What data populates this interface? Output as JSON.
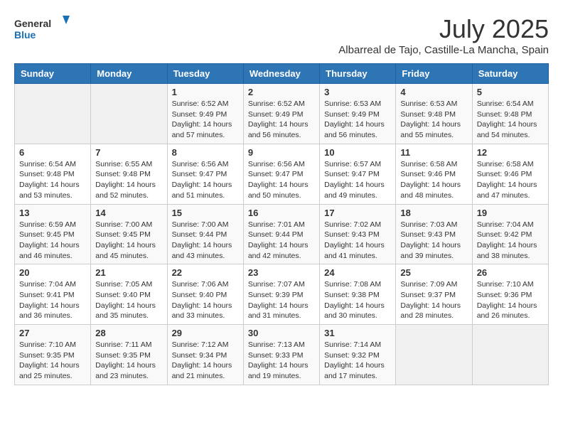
{
  "logo": {
    "general": "General",
    "blue": "Blue"
  },
  "title": "July 2025",
  "subtitle": "Albarreal de Tajo, Castille-La Mancha, Spain",
  "days_of_week": [
    "Sunday",
    "Monday",
    "Tuesday",
    "Wednesday",
    "Thursday",
    "Friday",
    "Saturday"
  ],
  "weeks": [
    [
      {
        "day": "",
        "info": ""
      },
      {
        "day": "",
        "info": ""
      },
      {
        "day": "1",
        "info": "Sunrise: 6:52 AM\nSunset: 9:49 PM\nDaylight: 14 hours and 57 minutes."
      },
      {
        "day": "2",
        "info": "Sunrise: 6:52 AM\nSunset: 9:49 PM\nDaylight: 14 hours and 56 minutes."
      },
      {
        "day": "3",
        "info": "Sunrise: 6:53 AM\nSunset: 9:49 PM\nDaylight: 14 hours and 56 minutes."
      },
      {
        "day": "4",
        "info": "Sunrise: 6:53 AM\nSunset: 9:48 PM\nDaylight: 14 hours and 55 minutes."
      },
      {
        "day": "5",
        "info": "Sunrise: 6:54 AM\nSunset: 9:48 PM\nDaylight: 14 hours and 54 minutes."
      }
    ],
    [
      {
        "day": "6",
        "info": "Sunrise: 6:54 AM\nSunset: 9:48 PM\nDaylight: 14 hours and 53 minutes."
      },
      {
        "day": "7",
        "info": "Sunrise: 6:55 AM\nSunset: 9:48 PM\nDaylight: 14 hours and 52 minutes."
      },
      {
        "day": "8",
        "info": "Sunrise: 6:56 AM\nSunset: 9:47 PM\nDaylight: 14 hours and 51 minutes."
      },
      {
        "day": "9",
        "info": "Sunrise: 6:56 AM\nSunset: 9:47 PM\nDaylight: 14 hours and 50 minutes."
      },
      {
        "day": "10",
        "info": "Sunrise: 6:57 AM\nSunset: 9:47 PM\nDaylight: 14 hours and 49 minutes."
      },
      {
        "day": "11",
        "info": "Sunrise: 6:58 AM\nSunset: 9:46 PM\nDaylight: 14 hours and 48 minutes."
      },
      {
        "day": "12",
        "info": "Sunrise: 6:58 AM\nSunset: 9:46 PM\nDaylight: 14 hours and 47 minutes."
      }
    ],
    [
      {
        "day": "13",
        "info": "Sunrise: 6:59 AM\nSunset: 9:45 PM\nDaylight: 14 hours and 46 minutes."
      },
      {
        "day": "14",
        "info": "Sunrise: 7:00 AM\nSunset: 9:45 PM\nDaylight: 14 hours and 45 minutes."
      },
      {
        "day": "15",
        "info": "Sunrise: 7:00 AM\nSunset: 9:44 PM\nDaylight: 14 hours and 43 minutes."
      },
      {
        "day": "16",
        "info": "Sunrise: 7:01 AM\nSunset: 9:44 PM\nDaylight: 14 hours and 42 minutes."
      },
      {
        "day": "17",
        "info": "Sunrise: 7:02 AM\nSunset: 9:43 PM\nDaylight: 14 hours and 41 minutes."
      },
      {
        "day": "18",
        "info": "Sunrise: 7:03 AM\nSunset: 9:43 PM\nDaylight: 14 hours and 39 minutes."
      },
      {
        "day": "19",
        "info": "Sunrise: 7:04 AM\nSunset: 9:42 PM\nDaylight: 14 hours and 38 minutes."
      }
    ],
    [
      {
        "day": "20",
        "info": "Sunrise: 7:04 AM\nSunset: 9:41 PM\nDaylight: 14 hours and 36 minutes."
      },
      {
        "day": "21",
        "info": "Sunrise: 7:05 AM\nSunset: 9:40 PM\nDaylight: 14 hours and 35 minutes."
      },
      {
        "day": "22",
        "info": "Sunrise: 7:06 AM\nSunset: 9:40 PM\nDaylight: 14 hours and 33 minutes."
      },
      {
        "day": "23",
        "info": "Sunrise: 7:07 AM\nSunset: 9:39 PM\nDaylight: 14 hours and 31 minutes."
      },
      {
        "day": "24",
        "info": "Sunrise: 7:08 AM\nSunset: 9:38 PM\nDaylight: 14 hours and 30 minutes."
      },
      {
        "day": "25",
        "info": "Sunrise: 7:09 AM\nSunset: 9:37 PM\nDaylight: 14 hours and 28 minutes."
      },
      {
        "day": "26",
        "info": "Sunrise: 7:10 AM\nSunset: 9:36 PM\nDaylight: 14 hours and 26 minutes."
      }
    ],
    [
      {
        "day": "27",
        "info": "Sunrise: 7:10 AM\nSunset: 9:35 PM\nDaylight: 14 hours and 25 minutes."
      },
      {
        "day": "28",
        "info": "Sunrise: 7:11 AM\nSunset: 9:35 PM\nDaylight: 14 hours and 23 minutes."
      },
      {
        "day": "29",
        "info": "Sunrise: 7:12 AM\nSunset: 9:34 PM\nDaylight: 14 hours and 21 minutes."
      },
      {
        "day": "30",
        "info": "Sunrise: 7:13 AM\nSunset: 9:33 PM\nDaylight: 14 hours and 19 minutes."
      },
      {
        "day": "31",
        "info": "Sunrise: 7:14 AM\nSunset: 9:32 PM\nDaylight: 14 hours and 17 minutes."
      },
      {
        "day": "",
        "info": ""
      },
      {
        "day": "",
        "info": ""
      }
    ]
  ]
}
